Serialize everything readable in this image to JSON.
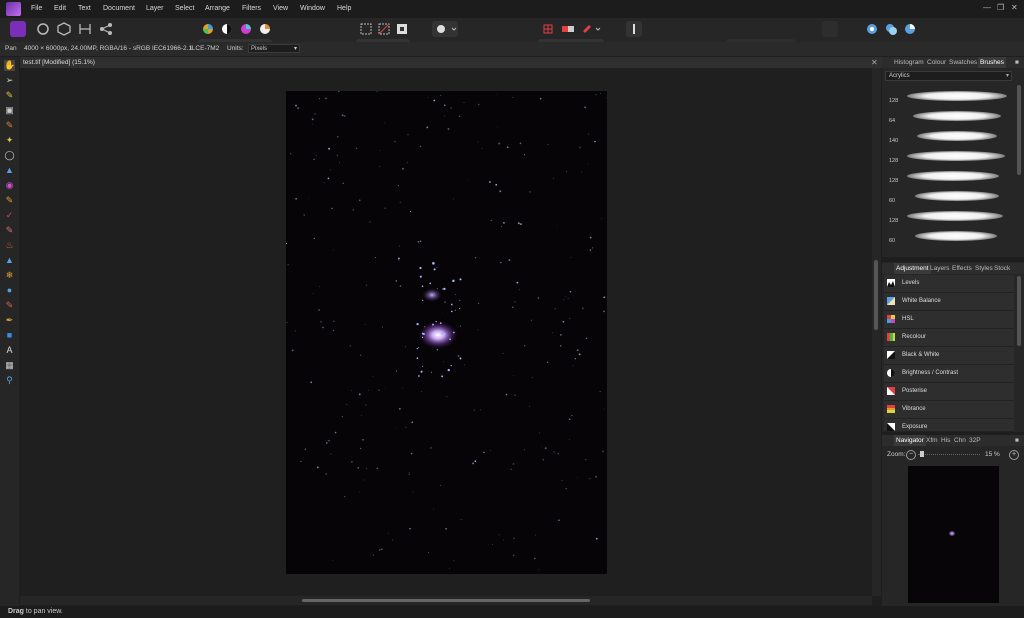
{
  "menu": [
    "File",
    "Edit",
    "Text",
    "Document",
    "Layer",
    "Select",
    "Arrange",
    "Filters",
    "View",
    "Window",
    "Help"
  ],
  "context": {
    "tool_name": "Pan",
    "doc_info": "4000 × 6000px, 24.00MP, RGBA/16 - sRGB IEC61966-2.1",
    "camera": "ILCE-7M2",
    "units_label": "Units:",
    "units_value": "Pixels"
  },
  "document": {
    "title": "test.tif [Modified] (15.1%)"
  },
  "panels": {
    "top_tabs": [
      "Histogram",
      "Colour",
      "Swatches",
      "Brushes"
    ],
    "brush_category": "Acrylics",
    "brush_sizes": [
      "128",
      "64",
      "140",
      "128",
      "128",
      "60",
      "128",
      "60"
    ],
    "mid_tabs": [
      "Adjustment",
      "Layers",
      "Effects",
      "Styles",
      "Stock"
    ],
    "adjustments": [
      "Levels",
      "White Balance",
      "HSL",
      "Recolour",
      "Black & White",
      "Brightness / Contrast",
      "Posterise",
      "Vibrance",
      "Exposure"
    ],
    "bottom_tabs": [
      "Navigator",
      "Xfm",
      "His",
      "Chn",
      "32P"
    ],
    "zoom_label": "Zoom:",
    "zoom_value": "15 %"
  },
  "status": {
    "bold": "Drag",
    "rest": " to pan view."
  },
  "colors": {
    "accent": "#6b2fa8",
    "canvas": "#060407",
    "panel": "#262626"
  }
}
